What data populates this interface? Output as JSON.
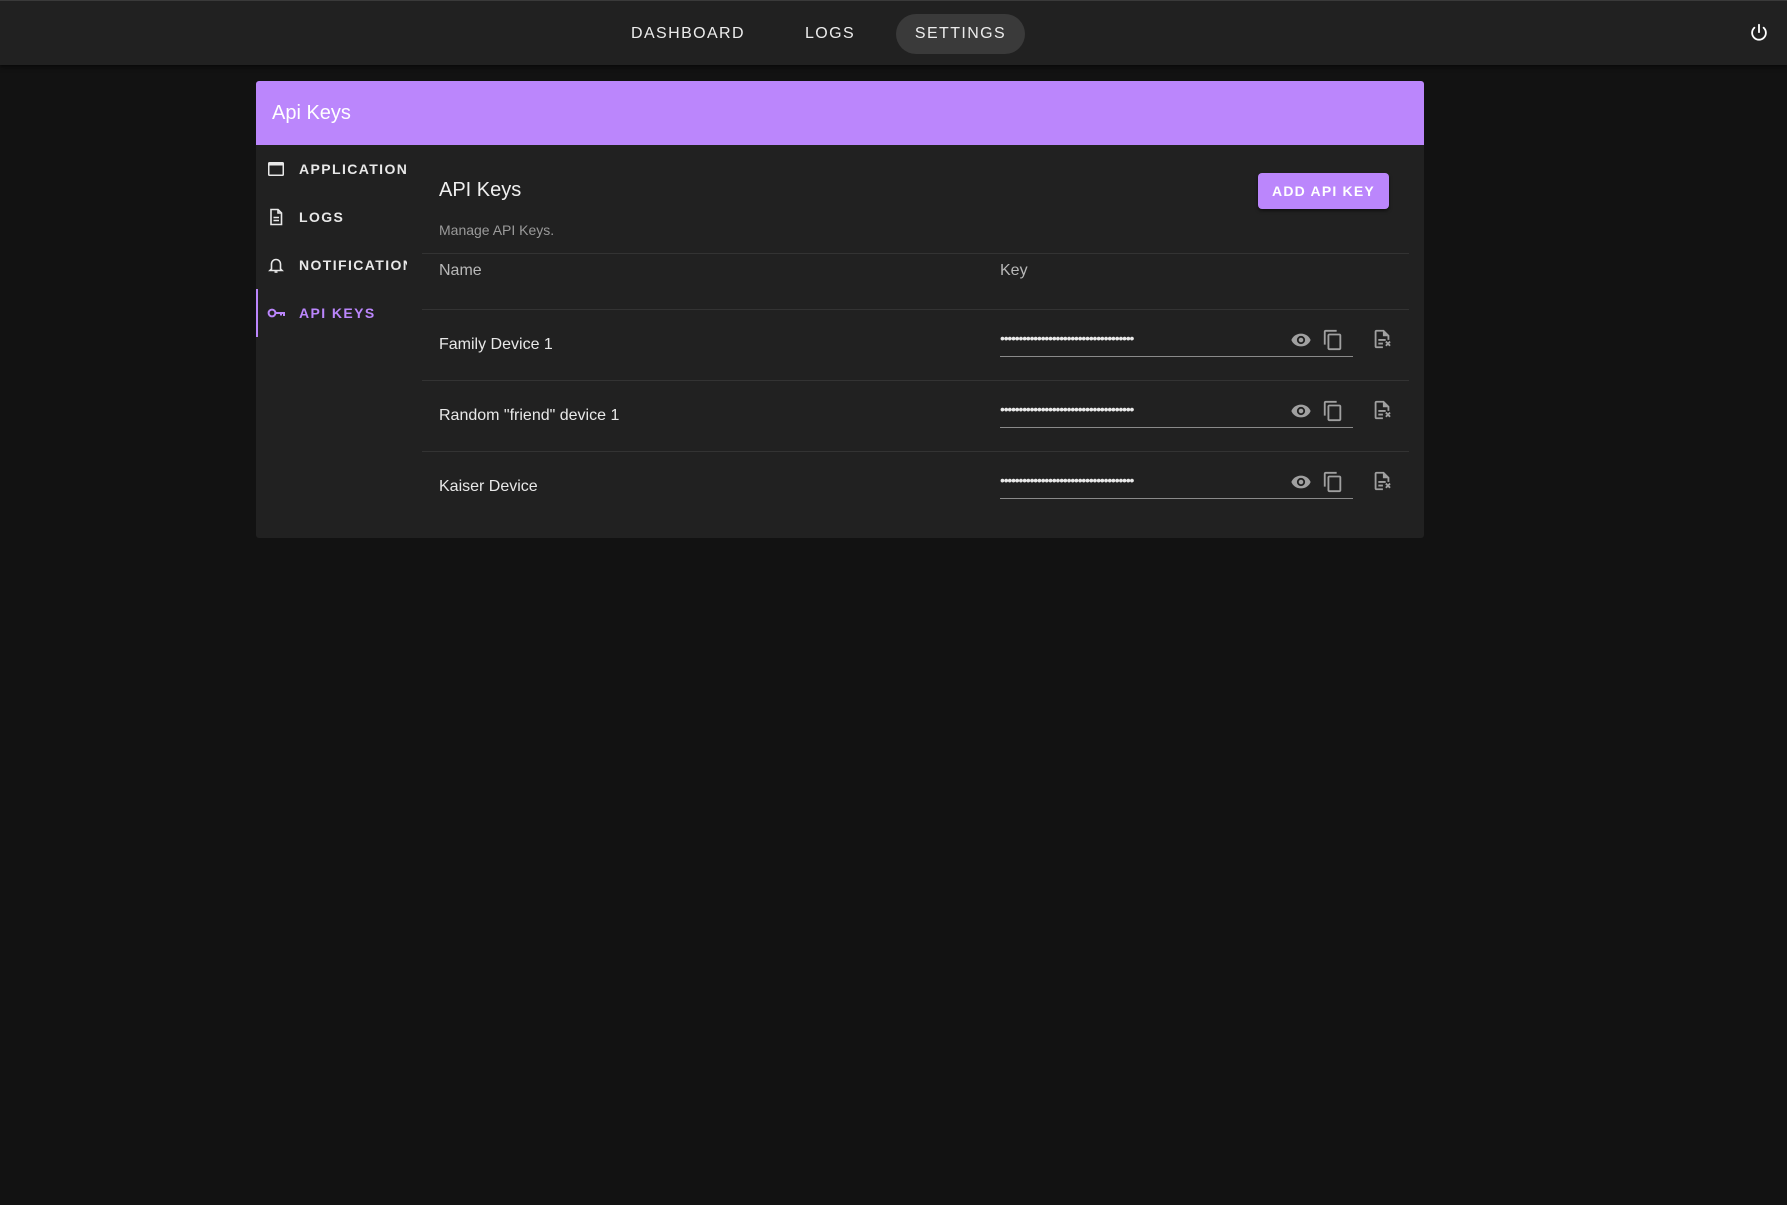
{
  "topbar": {
    "nav": [
      {
        "label": "DASHBOARD",
        "active": false
      },
      {
        "label": "LOGS",
        "active": false
      },
      {
        "label": "SETTINGS",
        "active": true
      }
    ],
    "power_icon": "power-icon"
  },
  "card": {
    "header_title": "Api Keys"
  },
  "sidemenu": {
    "items": [
      {
        "label": "APPLICATION",
        "icon": "application-window-icon",
        "active": false
      },
      {
        "label": "LOGS",
        "icon": "document-icon",
        "active": false
      },
      {
        "label": "NOTIFICATIONS",
        "icon": "bell-icon",
        "active": false
      },
      {
        "label": "API KEYS",
        "icon": "key-icon",
        "active": true
      }
    ]
  },
  "content": {
    "title": "API Keys",
    "subtitle": "Manage API Keys.",
    "add_button_label": "ADD API KEY",
    "table": {
      "headers": {
        "name": "Name",
        "key": "Key"
      },
      "rows": [
        {
          "name": "Family Device 1",
          "key_masked": "••••••••••••••••••••••••••••••••••••"
        },
        {
          "name": "Random \"friend\" device 1",
          "key_masked": "••••••••••••••••••••••••••••••••••••"
        },
        {
          "name": "Kaiser Device",
          "key_masked": "••••••••••••••••••••••••••••••••••••"
        }
      ]
    }
  },
  "colors": {
    "accent": "#bb86fc",
    "background": "#121212",
    "surface": "#212121",
    "topbar": "#212121"
  }
}
